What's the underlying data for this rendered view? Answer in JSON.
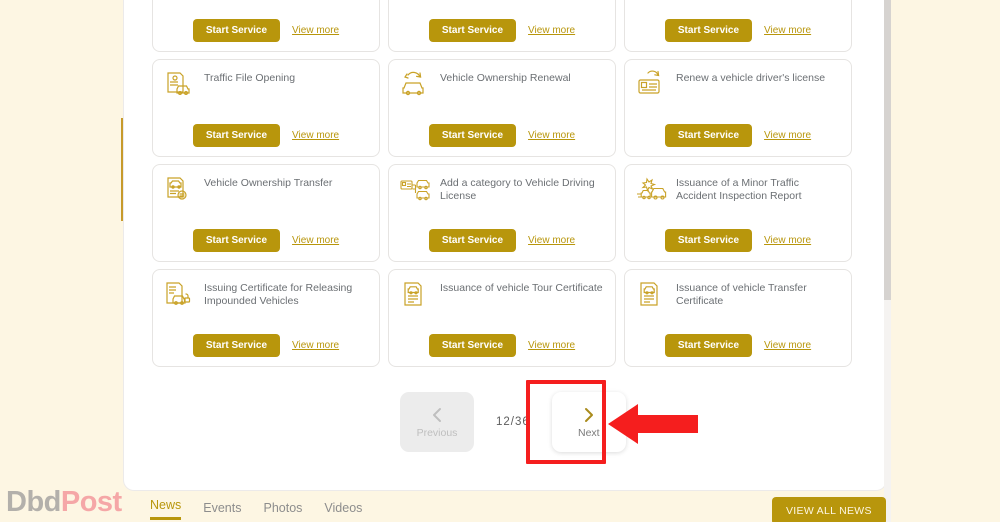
{
  "theme": {
    "gold": "#b8960c",
    "page_bg": "#fdf6e3",
    "card_border": "#e6e4e2",
    "text_gray": "#6b6f73",
    "highlight_red": "#f51e1e"
  },
  "services": {
    "start_label": "Start Service",
    "view_label": "View more",
    "rows": [
      {
        "cards": [
          {
            "title": "",
            "icon": "clipped-card-icon",
            "clipped": true
          },
          {
            "title": "",
            "icon": "clipped-card-icon",
            "clipped": true
          },
          {
            "title": "",
            "icon": "clipped-card-icon",
            "clipped": true
          }
        ]
      },
      {
        "cards": [
          {
            "title": "Traffic File Opening",
            "icon": "document-car-icon"
          },
          {
            "title": "Vehicle Ownership Renewal",
            "icon": "car-renew-icon"
          },
          {
            "title": "Renew a vehicle driver's license",
            "icon": "license-renew-icon"
          }
        ]
      },
      {
        "cards": [
          {
            "title": "Vehicle Ownership Transfer",
            "icon": "document-transfer-icon"
          },
          {
            "title": "Add a category to Vehicle Driving License",
            "icon": "license-add-category-icon"
          },
          {
            "title": "Issuance of a Minor Traffic Accident Inspection Report",
            "icon": "car-collision-icon"
          }
        ]
      },
      {
        "cards": [
          {
            "title": "Issuing Certificate for Releasing Impounded Vehicles",
            "icon": "document-impound-icon"
          },
          {
            "title": "Issuance of vehicle Tour Certificate",
            "icon": "certificate-car-icon"
          },
          {
            "title": "Issuance of vehicle Transfer Certificate",
            "icon": "certificate-car-icon"
          }
        ]
      }
    ]
  },
  "pagination": {
    "previous_label": "Previous",
    "next_label": "Next",
    "counter": "12/36",
    "current_page": 12,
    "total_pages": 36,
    "previous_enabled": false,
    "next_enabled": true
  },
  "annotation": {
    "highlight_target": "next-button",
    "arrow_direction": "left",
    "arrow_color": "#f51e1e"
  },
  "footer": {
    "tabs": [
      {
        "label": "News",
        "active": true
      },
      {
        "label": "Events",
        "active": false
      },
      {
        "label": "Photos",
        "active": false
      },
      {
        "label": "Videos",
        "active": false
      }
    ],
    "view_all_label": "VIEW ALL NEWS"
  },
  "watermark": {
    "part_one": "Dbd",
    "part_two": "Post"
  }
}
